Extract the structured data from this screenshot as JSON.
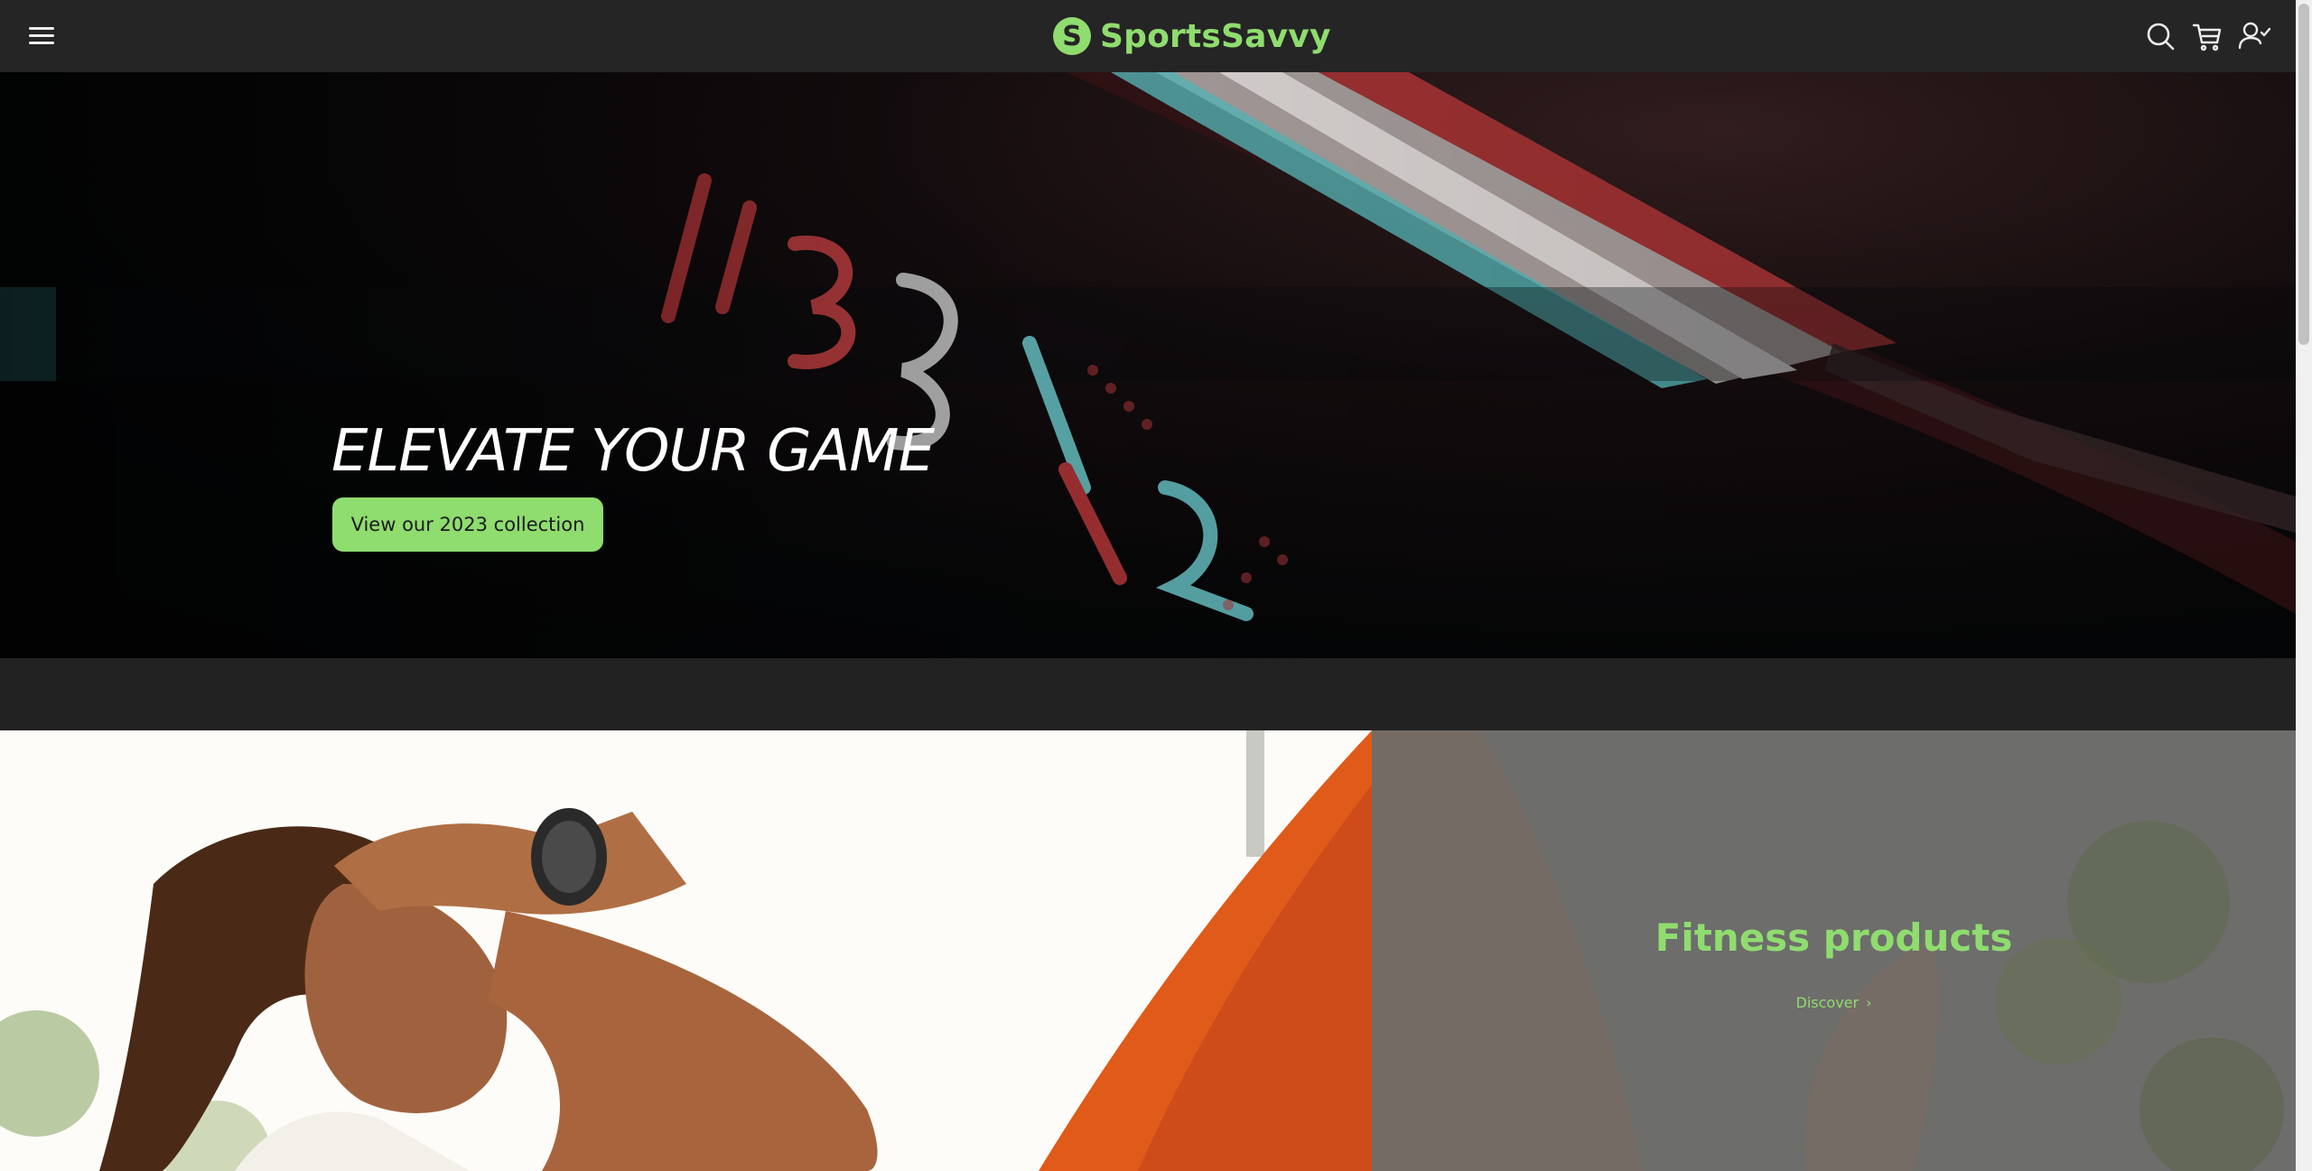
{
  "brand": {
    "name": "SportsSavvy",
    "mark": "S",
    "accent_color": "#8fdc6f"
  },
  "header": {
    "menu_icon": "hamburger-menu-icon",
    "search_icon": "search-icon",
    "cart_icon": "cart-icon",
    "account_icon": "user-account-icon"
  },
  "hero": {
    "title": "ELEVATE YOUR GAME",
    "button_label": "View our 2023 collection"
  },
  "promo": {
    "title": "Fitness products",
    "link_label": "Discover",
    "link_icon": "chevron-right-icon"
  }
}
